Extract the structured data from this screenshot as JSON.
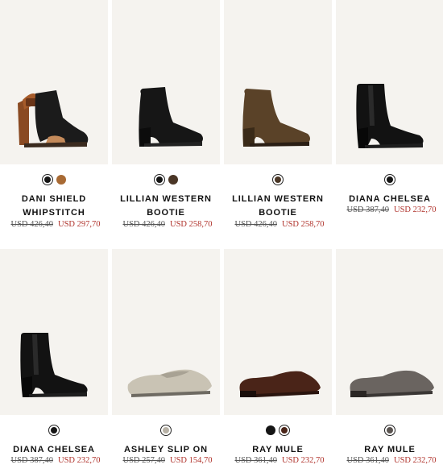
{
  "products": [
    {
      "name_line1": "DANI SHIELD",
      "name_line2": "WHIPSTITCH",
      "old_price": "USD 426,40",
      "new_price": "USD 297,70",
      "image": "black-suede-peep-toe-bootie",
      "swatches": [
        {
          "color": "#151515",
          "selected": true
        },
        {
          "color": "#a86a34",
          "selected": false
        }
      ]
    },
    {
      "name_line1": "LILLIAN WESTERN",
      "name_line2": "BOOTIE",
      "old_price": "USD 426,40",
      "new_price": "USD 258,70",
      "image": "black-suede-western-bootie",
      "swatches": [
        {
          "color": "#151515",
          "selected": true
        },
        {
          "color": "#4a3626",
          "selected": false
        }
      ]
    },
    {
      "name_line1": "LILLIAN WESTERN",
      "name_line2": "BOOTIE",
      "old_price": "USD 426,40",
      "new_price": "USD 258,70",
      "image": "brown-suede-western-bootie",
      "swatches": [
        {
          "color": "#4a3626",
          "selected": true
        }
      ]
    },
    {
      "name_line1": "DIANA CHELSEA",
      "name_line2": "",
      "old_price": "USD 387,40",
      "new_price": "USD 232,70",
      "image": "black-leather-chelsea-boot",
      "swatches": [
        {
          "color": "#151515",
          "selected": true
        }
      ]
    },
    {
      "name_line1": "DIANA CHELSEA",
      "name_line2": "",
      "old_price": "USD 387,40",
      "new_price": "USD 232,70",
      "image": "black-leather-chelsea-boot",
      "swatches": [
        {
          "color": "#151515",
          "selected": true
        }
      ]
    },
    {
      "name_line1": "ASHLEY SLIP ON",
      "name_line2": "",
      "old_price": "USD 257,40",
      "new_price": "USD 154,70",
      "image": "metallic-silver-slip-on",
      "swatches": [
        {
          "color": "#b8b2a6",
          "selected": true
        }
      ]
    },
    {
      "name_line1": "RAY MULE",
      "name_line2": "",
      "old_price": "USD 361,40",
      "new_price": "USD 232,70",
      "image": "brown-leather-mule",
      "swatches": [
        {
          "color": "#151515",
          "selected": false
        },
        {
          "color": "#4a2418",
          "selected": true
        }
      ]
    },
    {
      "name_line1": "RAY MULE",
      "name_line2": "",
      "old_price": "USD 361,40",
      "new_price": "USD 232,70",
      "image": "grey-leather-mule",
      "swatches": [
        {
          "color": "#5a5450",
          "selected": true
        }
      ]
    }
  ],
  "colors": {
    "sale_price": "#b0332c",
    "image_bg": "#f5f3ef"
  }
}
